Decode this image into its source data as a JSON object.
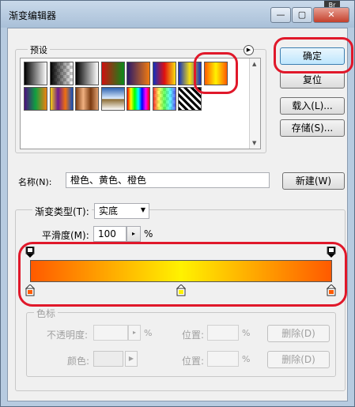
{
  "window": {
    "title": "渐变编辑器",
    "minimize_glyph": "—",
    "restore_glyph": "▢",
    "close_glyph": "✕",
    "corner_badge": "Br"
  },
  "presets": {
    "label": "预设",
    "menu_icon": "circle-arrow-right-icon",
    "swatches": [
      {
        "name": "foreground-to-background",
        "css": "linear-gradient(to right,#000,#fff)"
      },
      {
        "name": "foreground-to-transparent",
        "css": "linear-gradient(to right,#000,rgba(0,0,0,0)),repeating-conic-gradient(#ccc 0 25%,#fff 0 50%) 0 0/8px 8px"
      },
      {
        "name": "black-white",
        "css": "linear-gradient(to right,#000,#fff)"
      },
      {
        "name": "red-green",
        "css": "linear-gradient(to right,#d01010,#0a8a1a)"
      },
      {
        "name": "violet-orange",
        "css": "linear-gradient(to right,#2a1a6a,#f07a10)"
      },
      {
        "name": "blue-red-yellow",
        "css": "linear-gradient(to right,#1030c0,#e01010,#f8e010)"
      },
      {
        "name": "blue-yellow-blue",
        "css": "linear-gradient(to right,#1030c0,#f8e010,#1030c0)"
      },
      {
        "name": "orange-yellow-orange",
        "css": "linear-gradient(to right,#ff5a00,#fff200,#ff5a00)"
      },
      {
        "name": "violet-green-orange",
        "css": "linear-gradient(to right,#4a1080,#10a040,#f08010)"
      },
      {
        "name": "yellow-violet-orange-blue",
        "css": "linear-gradient(to right,#f8d010,#6a1a90,#f07010,#1050c0)"
      },
      {
        "name": "copper",
        "css": "linear-gradient(to right,#7a3a10,#f0b080,#7a3a10,#e0a070)"
      },
      {
        "name": "chrome",
        "css": "linear-gradient(to bottom,#2a60b0,#e0f0ff 50%,#8a6a30 52%,#fff)"
      },
      {
        "name": "spectrum",
        "css": "linear-gradient(to right,#f00,#ff0,#0f0,#0ff,#00f,#f0f,#f00)"
      },
      {
        "name": "transparent-rainbow",
        "css": "linear-gradient(to right,rgba(255,0,0,.8),rgba(255,255,0,.6),rgba(0,255,0,.6),rgba(0,255,255,.6),rgba(0,0,255,.6)),repeating-conic-gradient(#ccc 0 25%,#fff 0 50%) 0 0/8px 8px"
      },
      {
        "name": "transparent-stripes",
        "css": "repeating-linear-gradient(45deg,#000 0 3px,#fff 3px 6px)"
      }
    ]
  },
  "buttons": {
    "ok": "确定",
    "reset": "复位",
    "load": "载入(L)...",
    "save": "存储(S)...",
    "new": "新建(W)"
  },
  "name_field": {
    "label": "名称(N):",
    "value": "橙色、黄色、橙色"
  },
  "gradient": {
    "type_label": "渐变类型(T):",
    "type_value": "实底",
    "smoothness_label": "平滑度(M):",
    "smoothness_value": "100",
    "smoothness_unit": "%",
    "bar_css": "linear-gradient(to right,#ff5a00,#fff200 50%,#ff5a00)",
    "color_stop_colors": [
      "#ff5a00",
      "#fff200",
      "#ff5a00"
    ]
  },
  "stops": {
    "group_label": "色标",
    "opacity_label": "不透明度:",
    "opacity_unit": "%",
    "location_label": "位置:",
    "location_unit": "%",
    "delete_label": "删除(D)",
    "color_label": "颜色:"
  },
  "colors": {
    "highlight_oval": "#e0182a",
    "accent_blue": "#3c7fb1"
  }
}
